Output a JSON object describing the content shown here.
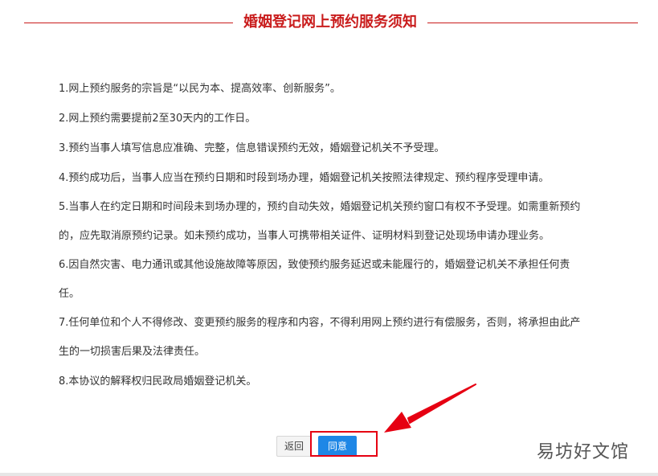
{
  "page": {
    "title": "婚姻登记网上预约服务须知"
  },
  "terms": [
    {
      "lines": [
        "1.网上预约服务的宗旨是“以民为本、提高效率、创新服务”。"
      ]
    },
    {
      "lines": [
        "2.网上预约需要提前2至30天内的工作日。"
      ]
    },
    {
      "lines": [
        "3.预约当事人填写信息应准确、完整，信息错误预约无效，婚姻登记机关不予受理。"
      ]
    },
    {
      "lines": [
        "4.预约成功后，当事人应当在预约日期和时段到场办理，婚姻登记机关按照法律规定、预约程序受理申请。"
      ]
    },
    {
      "lines": [
        "5.当事人在约定日期和时间段未到场办理的，预约自动失效，婚姻登记机关预约窗口有权不予受理。如需重新预约",
        "的，应先取消原预约记录。如未预约成功，当事人可携带相关证件、证明材料到登记处现场申请办理业务。"
      ]
    },
    {
      "lines": [
        "6.因自然灾害、电力通讯或其他设施故障等原因，致使预约服务延迟或未能履行的，婚姻登记机关不承担任何责",
        "任。"
      ]
    },
    {
      "lines": [
        "7.任何单位和个人不得修改、变更预约服务的程序和内容，不得利用网上预约进行有偿服务，否则，将承担由此产",
        "生的一切损害后果及法律责任。"
      ]
    },
    {
      "lines": [
        "8.本协议的解释权归民政局婚姻登记机关。"
      ]
    }
  ],
  "buttons": {
    "back_label": "返回",
    "agree_label": "同意"
  },
  "annotation": {
    "color": "#e60012"
  },
  "watermark": {
    "text": "易坊好文馆"
  },
  "colors": {
    "title_red": "#c91c1c",
    "primary_blue": "#1e87e6"
  }
}
